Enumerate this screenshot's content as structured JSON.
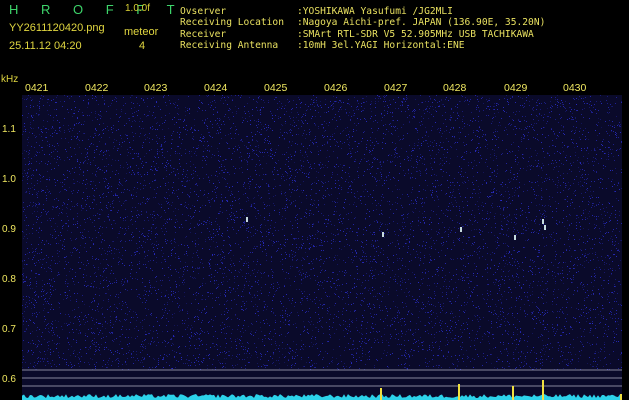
{
  "header": {
    "brand": "H R O F F T",
    "version": "1.0.0f",
    "filename": "YY2611120420.png",
    "datetime": "25.11.12 04:20",
    "meteor_label": "meteor",
    "meteor_count": "4",
    "info_rows": [
      {
        "label": "Ovserver",
        "value": ":YOSHIKAWA Yasufumi /JG2MLI"
      },
      {
        "label": "Receiving Location",
        "value": ":Nagoya Aichi-pref. JAPAN (136.90E, 35.20N)"
      },
      {
        "label": "Receiver",
        "value": ":SMArt RTL-SDR V5 52.905MHz USB TACHIKAWA"
      },
      {
        "label": "Receiving Antenna",
        "value": ":10mH 3el.YAGI Horizontal:ENE"
      }
    ]
  },
  "spectrogram": {
    "unit_label": "kHz",
    "time_labels": [
      "0421",
      "0422",
      "0423",
      "0424",
      "0425",
      "0426",
      "0427",
      "0428",
      "0429",
      "0430"
    ],
    "freq_labels": [
      "1.1",
      "1.0",
      "0.9",
      "0.8",
      "0.7",
      "0.6"
    ],
    "background_color": "#0a0a2a",
    "noise_color": "#2b2fd0",
    "echo_color": "#e8ffff",
    "profile_color": "#30e8ff",
    "marker_color": "#f0e040",
    "reference_line_color": "#d8d8e8"
  }
}
